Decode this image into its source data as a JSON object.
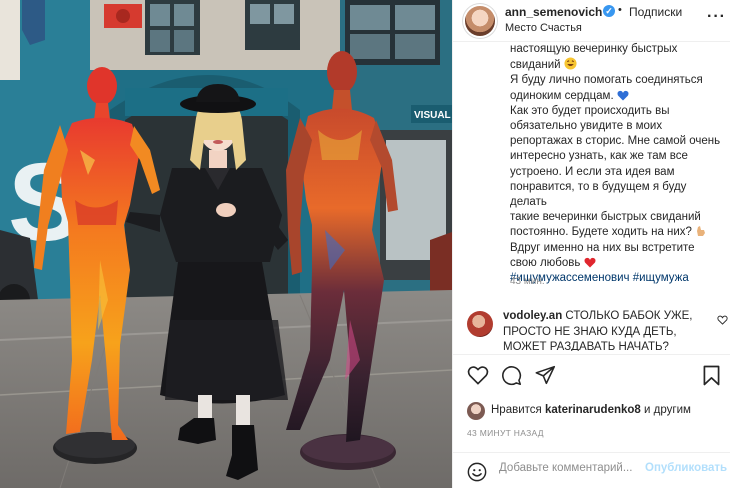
{
  "post": {
    "username": "ann_semenovich",
    "follow_state": "Подписки",
    "separator": "•",
    "location": "Место Счастья",
    "more_icon": "more-horizontal-icon",
    "verified_icon": "verified-badge-icon"
  },
  "caption": {
    "lines": [
      "настоящую вечеринку быстрых",
      "свиданий",
      "Я буду лично помогать соединяться",
      "одиноким сердцам.",
      "Как это будет происходить вы",
      "обязательно увидите в моих",
      "репортажах в сторис. Мне самой очень",
      "интересно узнать, как же там все",
      "устроено. И если эта идея вам",
      "понравится, то в будущем я буду делать",
      "такие вечеринки быстрых свиданий",
      "постоянно. Будете ходить на них?",
      "Вдруг именно на них вы встретите",
      "свою любовь"
    ],
    "hashtags": "#ищумужассеменович #ищумужа",
    "time": "43 мин."
  },
  "comment": {
    "username": "vodoley.an",
    "text": "СТОЛЬКО БАБОК УЖЕ, ПРОСТО НЕ ЗНАЮ КУДА ДЕТЬ, МОЖЕТ РАЗДАВАТЬ НАЧАТЬ?"
  },
  "likes": {
    "prefix": "Нравится",
    "user": "katerinarudenko8",
    "suffix": "и другим"
  },
  "timestamp": "43 МИНУТ НАЗАД",
  "add_comment": {
    "placeholder": "Добавьте комментарий...",
    "publish_label": "Опубликовать"
  },
  "photo": {
    "sign_text": "VISUAL",
    "icons": [
      "heart-icon",
      "comment-icon",
      "share-icon",
      "bookmark-icon",
      "emoji-icon"
    ]
  },
  "colors": {
    "link": "#00376b",
    "secondary": "#8e8e8e",
    "publish_disabled": "#b2dffc",
    "verified": "#3897f0"
  }
}
